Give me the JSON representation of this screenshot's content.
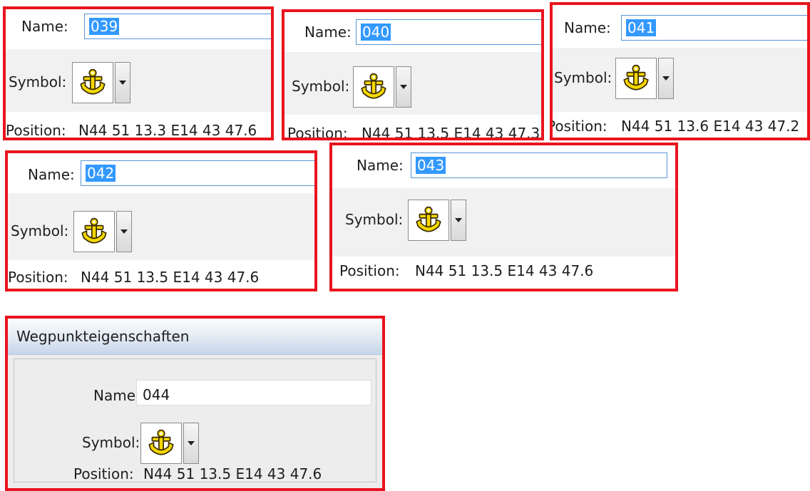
{
  "labels": {
    "name": "Name:",
    "symbol": "Symbol:",
    "position": "Position:"
  },
  "panels": [
    {
      "name": "039",
      "position": "N44 51 13.3 E14 43 47.6"
    },
    {
      "name": "040",
      "position": "N44 51 13.5 E14 43 47.3"
    },
    {
      "name": "041",
      "position": "N44 51 13.6 E14 43 47.2"
    },
    {
      "name": "042",
      "position": "N44 51 13.5 E14 43 47.6"
    },
    {
      "name": "043",
      "position": "N44 51 13.5 E14 43 47.6"
    }
  ],
  "dialog": {
    "title": "Wegpunkteigenschaften",
    "name": "044",
    "position": "N44 51 13.5 E14 43 47.6"
  },
  "symbol": {
    "icon": "anchor-icon",
    "color": "#f5d800"
  },
  "colors": {
    "highlight_border": "#e8141e",
    "selection": "#3399ff"
  }
}
